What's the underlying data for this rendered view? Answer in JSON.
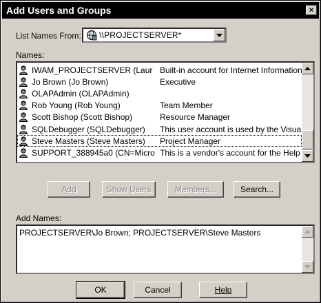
{
  "window": {
    "title": "Add Users and Groups",
    "close_symbol": "×"
  },
  "list_from": {
    "label": "List Names From:",
    "value": "\\\\PROJECTSERVER*"
  },
  "names": {
    "label": "Names:",
    "rows": [
      {
        "name": "IWAM_PROJECTSERVER (Laur",
        "description": "Built-in account for Internet Information S",
        "selected": false
      },
      {
        "name": "Jo Brown (Jo Brown)",
        "description": "Executive",
        "selected": false
      },
      {
        "name": "OLAPAdmin (OLAPAdmin)",
        "description": "",
        "selected": false
      },
      {
        "name": "Rob Young (Rob Young)",
        "description": "Team Member",
        "selected": false
      },
      {
        "name": "Scott Bishop (Scott Bishop)",
        "description": "Resource Manager",
        "selected": false
      },
      {
        "name": "SQLDebugger (SQLDebugger)",
        "description": "This user account is used by the Visual",
        "selected": false
      },
      {
        "name": "Steve Masters (Steve Masters)",
        "description": "Project Manager",
        "selected": true
      },
      {
        "name": "SUPPORT_388945a0 (CN=Micro",
        "description": "This is a vendor's account for the Help a",
        "selected": false
      }
    ]
  },
  "buttons": {
    "add": "Add",
    "show_users": "Show Users",
    "members": "Members...",
    "search": "Search..."
  },
  "add_names": {
    "label": "Add Names:",
    "value": "PROJECTSERVER\\Jo Brown; PROJECTSERVER\\Steve Masters"
  },
  "footer": {
    "ok": "OK",
    "cancel": "Cancel",
    "help": "Help"
  },
  "icons": {
    "list_source": "globe-server-icon",
    "account": "user-icon"
  }
}
